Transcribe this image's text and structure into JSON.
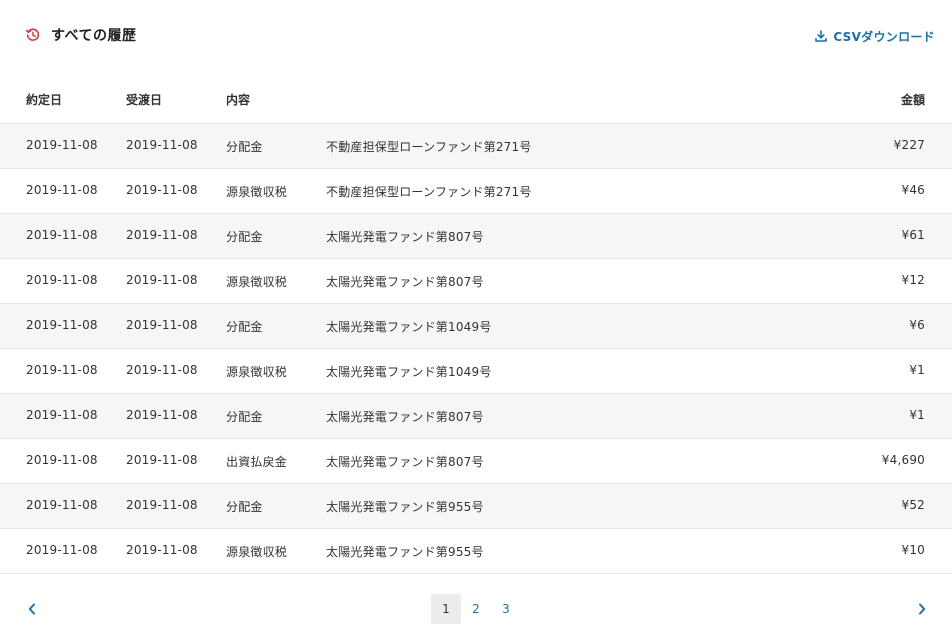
{
  "header": {
    "title": "すべての履歴",
    "history_icon": "history-clock-icon",
    "csv_label": "CSVダウンロード",
    "download_icon": "download-icon"
  },
  "table": {
    "columns": {
      "yakujo": "約定日",
      "ukewatashi": "受渡日",
      "naiyou": "内容",
      "kingaku": "金額"
    },
    "rows": [
      {
        "yakujo": "2019-11-08",
        "ukewatashi": "2019-11-08",
        "naiyou": "分配金",
        "fund": "不動産担保型ローンファンド第271号",
        "kingaku": "¥227"
      },
      {
        "yakujo": "2019-11-08",
        "ukewatashi": "2019-11-08",
        "naiyou": "源泉徴収税",
        "fund": "不動産担保型ローンファンド第271号",
        "kingaku": "¥46"
      },
      {
        "yakujo": "2019-11-08",
        "ukewatashi": "2019-11-08",
        "naiyou": "分配金",
        "fund": "太陽光発電ファンド第807号",
        "kingaku": "¥61"
      },
      {
        "yakujo": "2019-11-08",
        "ukewatashi": "2019-11-08",
        "naiyou": "源泉徴収税",
        "fund": "太陽光発電ファンド第807号",
        "kingaku": "¥12"
      },
      {
        "yakujo": "2019-11-08",
        "ukewatashi": "2019-11-08",
        "naiyou": "分配金",
        "fund": "太陽光発電ファンド第1049号",
        "kingaku": "¥6"
      },
      {
        "yakujo": "2019-11-08",
        "ukewatashi": "2019-11-08",
        "naiyou": "源泉徴収税",
        "fund": "太陽光発電ファンド第1049号",
        "kingaku": "¥1"
      },
      {
        "yakujo": "2019-11-08",
        "ukewatashi": "2019-11-08",
        "naiyou": "分配金",
        "fund": "太陽光発電ファンド第807号",
        "kingaku": "¥1"
      },
      {
        "yakujo": "2019-11-08",
        "ukewatashi": "2019-11-08",
        "naiyou": "出資払戻金",
        "fund": "太陽光発電ファンド第807号",
        "kingaku": "¥4,690"
      },
      {
        "yakujo": "2019-11-08",
        "ukewatashi": "2019-11-08",
        "naiyou": "分配金",
        "fund": "太陽光発電ファンド第955号",
        "kingaku": "¥52"
      },
      {
        "yakujo": "2019-11-08",
        "ukewatashi": "2019-11-08",
        "naiyou": "源泉徴収税",
        "fund": "太陽光発電ファンド第955号",
        "kingaku": "¥10"
      }
    ]
  },
  "pagination": {
    "pages": [
      "1",
      "2",
      "3"
    ],
    "current": "1",
    "prev_icon": "chevron-left-icon",
    "next_icon": "chevron-right-icon"
  },
  "colors": {
    "accent": "#1d6fa5",
    "history_icon": "#d9363e",
    "row_alt": "#f6f6f6",
    "divider": "#e6e6e6"
  }
}
